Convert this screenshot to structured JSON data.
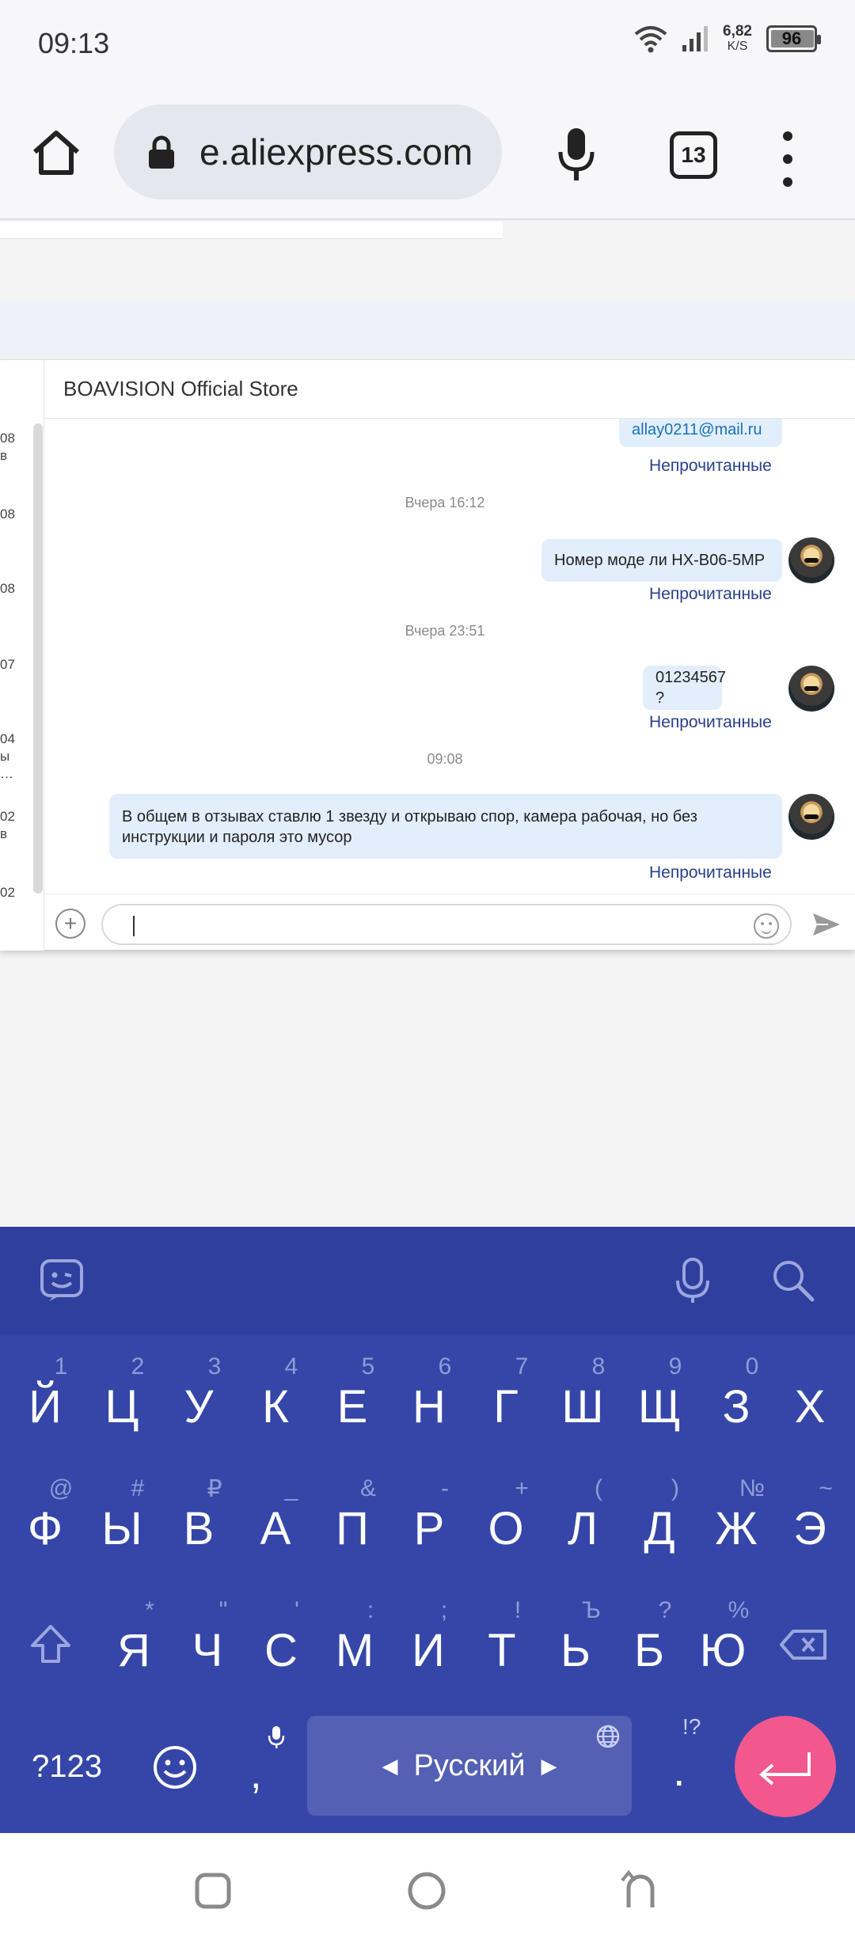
{
  "status_bar": {
    "time": "09:13",
    "net_speed_value": "6,82",
    "net_speed_unit": "K/S",
    "battery_level": "96",
    "icons": [
      "wifi-icon",
      "signal-icon"
    ]
  },
  "browser": {
    "url": "e.aliexpress.com",
    "tab_count": "13",
    "icons": [
      "home-icon",
      "lock-icon",
      "mic-icon",
      "tabs-icon",
      "more-vert-icon"
    ]
  },
  "chat": {
    "store_name": "BOAVISION Official Store",
    "left_list": [
      {
        "line1": "08",
        "line2": "в"
      },
      {
        "line1": "08",
        "line2": ""
      },
      {
        "line1": "08",
        "line2": ""
      },
      {
        "line1": "07",
        "line2": ""
      },
      {
        "line1": "04",
        "line2": "ы",
        "line3": "…"
      },
      {
        "line1": "02",
        "line2": "в"
      },
      {
        "line1": "02",
        "line2": ""
      }
    ],
    "messages": [
      {
        "type": "bubble",
        "text": "allay0211@mail.ru",
        "status": "Непрочитанные"
      },
      {
        "type": "date",
        "text": "Вчера 16:12"
      },
      {
        "type": "bubble",
        "text": "Номер моде ли HX-B06-5MP",
        "status": "Непрочитанные"
      },
      {
        "type": "date",
        "text": "Вчера 23:51"
      },
      {
        "type": "bubble",
        "text": "01234567 ?",
        "status": "Непрочитанные"
      },
      {
        "type": "date",
        "text": "09:08"
      },
      {
        "type": "bubble",
        "text": "В общем в отзывах ставлю 1 звезду и открываю спор, камера рабочая, но без инструкции и пароля это мусор",
        "status": "Непрочитанные"
      }
    ],
    "input_value": ""
  },
  "keyboard": {
    "row1": [
      {
        "main": "Й",
        "sub": "1"
      },
      {
        "main": "Ц",
        "sub": "2"
      },
      {
        "main": "У",
        "sub": "3"
      },
      {
        "main": "К",
        "sub": "4"
      },
      {
        "main": "Е",
        "sub": "5"
      },
      {
        "main": "Н",
        "sub": "6"
      },
      {
        "main": "Г",
        "sub": "7"
      },
      {
        "main": "Ш",
        "sub": "8"
      },
      {
        "main": "Щ",
        "sub": "9"
      },
      {
        "main": "З",
        "sub": "0"
      },
      {
        "main": "Х",
        "sub": ""
      }
    ],
    "row2": [
      {
        "main": "Ф",
        "sub": "@"
      },
      {
        "main": "Ы",
        "sub": "#"
      },
      {
        "main": "В",
        "sub": "₽"
      },
      {
        "main": "А",
        "sub": "_"
      },
      {
        "main": "П",
        "sub": "&"
      },
      {
        "main": "Р",
        "sub": "-"
      },
      {
        "main": "О",
        "sub": "+"
      },
      {
        "main": "Л",
        "sub": "("
      },
      {
        "main": "Д",
        "sub": ")"
      },
      {
        "main": "Ж",
        "sub": "№"
      },
      {
        "main": "Э",
        "sub": "~"
      }
    ],
    "row3": [
      {
        "main": "Я",
        "sub": "*"
      },
      {
        "main": "Ч",
        "sub": "\""
      },
      {
        "main": "С",
        "sub": "'"
      },
      {
        "main": "М",
        "sub": ":"
      },
      {
        "main": "И",
        "sub": ";"
      },
      {
        "main": "Т",
        "sub": "!"
      },
      {
        "main": "Ь",
        "sub": "Ъ"
      },
      {
        "main": "Б",
        "sub": "?"
      },
      {
        "main": "Ю",
        "sub": "%"
      }
    ],
    "symbols_key": "?123",
    "comma": ",",
    "space_label": "Русский",
    "period": ".",
    "period_sub": "!?",
    "accent_color": "#f2578e",
    "background_color": "#3546a8"
  },
  "nav_bar": {
    "icons": [
      "recents-icon",
      "home-circle-icon",
      "back-icon"
    ]
  }
}
